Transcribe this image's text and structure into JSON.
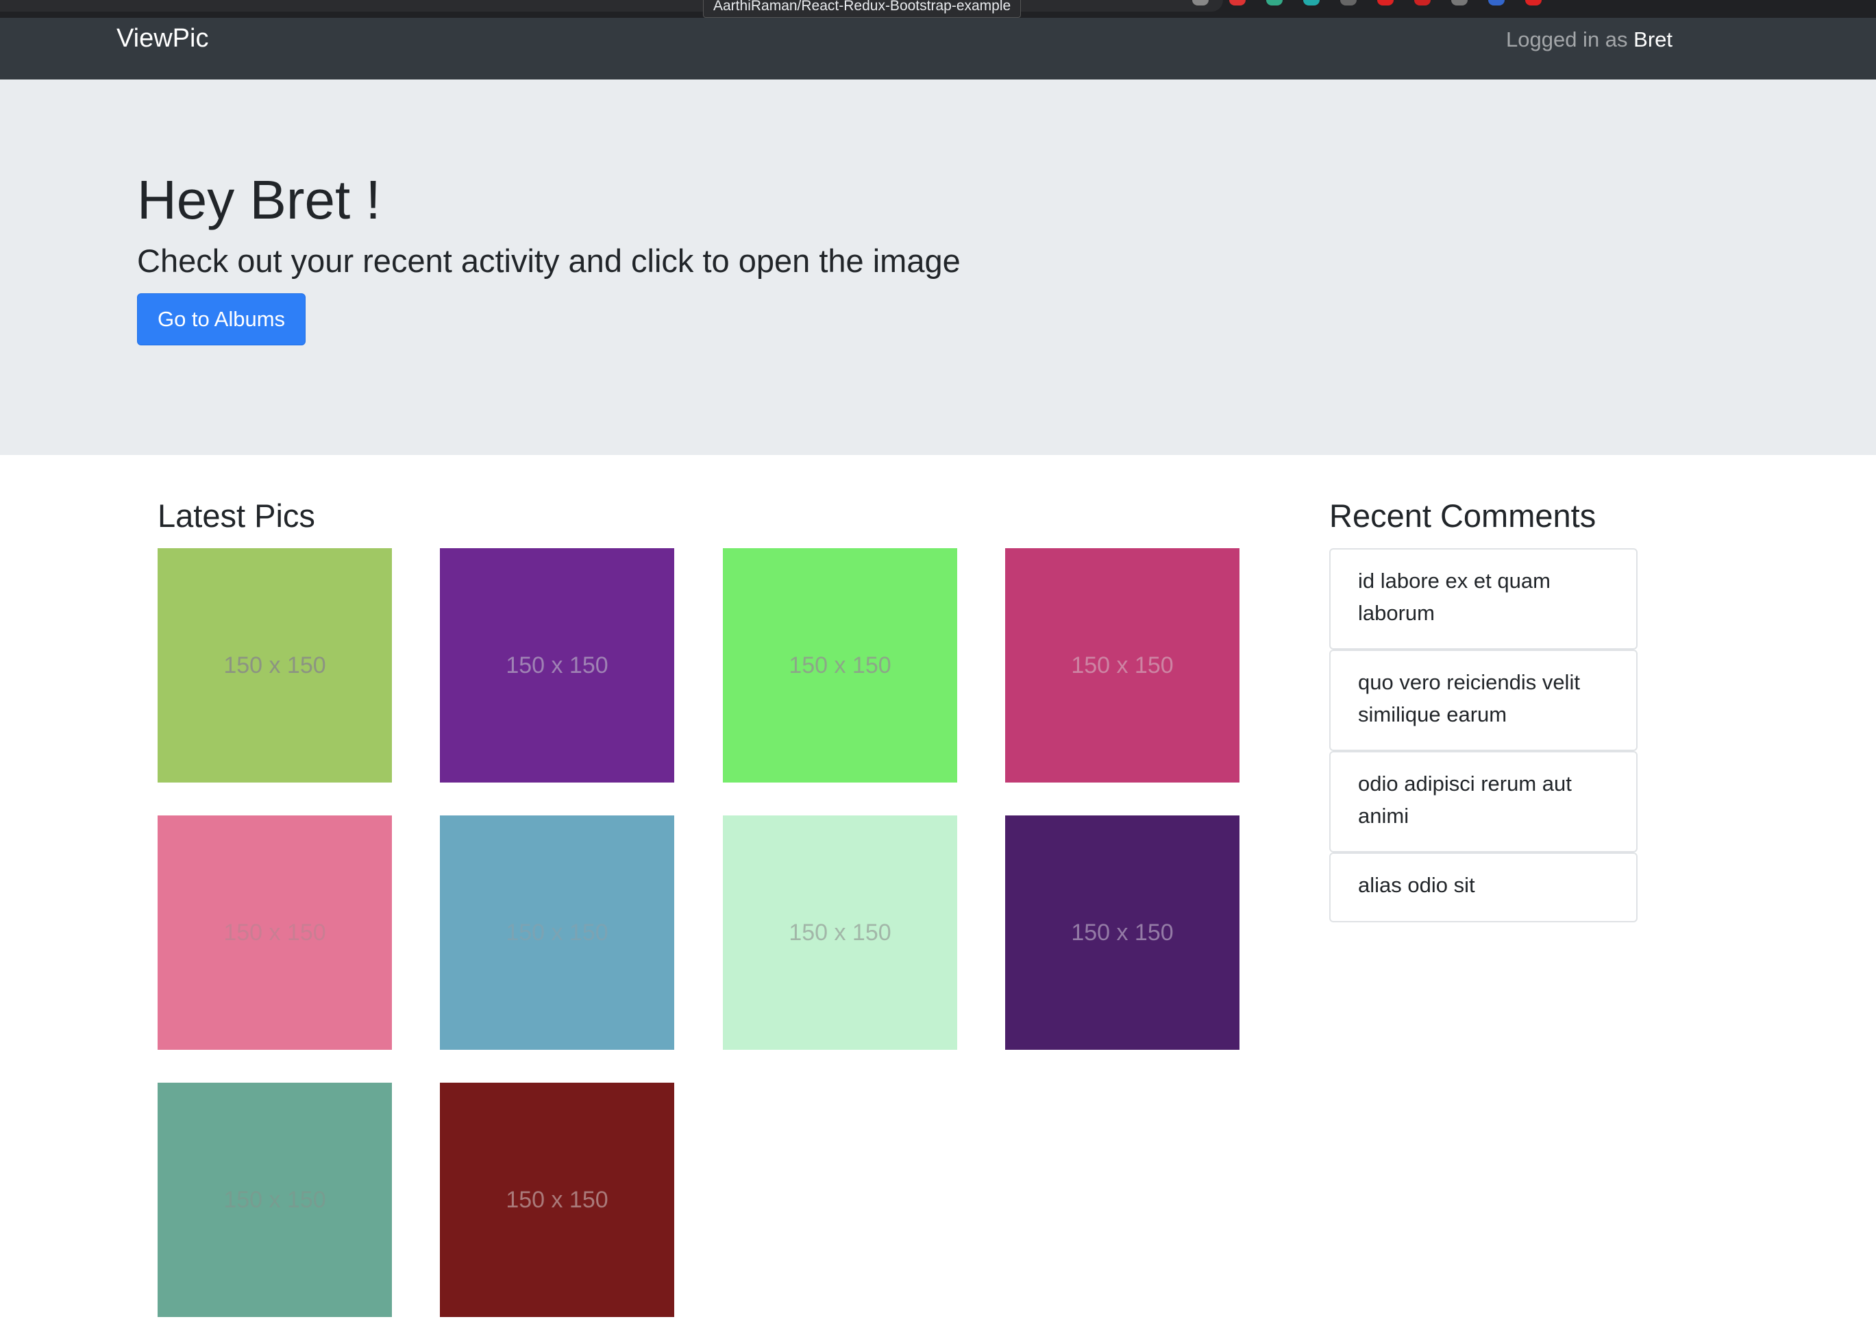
{
  "browser": {
    "tooltip": "AarthiRaman/React-Redux-Bootstrap-example"
  },
  "navbar": {
    "brand": "ViewPic",
    "logged_in_prefix": "Logged in as ",
    "user": "Bret"
  },
  "jumbotron": {
    "greeting": "Hey Bret !",
    "subtitle": "Check out your recent activity and click to open the image",
    "button_label": "Go to Albums"
  },
  "latest_pics": {
    "title": "Latest Pics",
    "items": [
      {
        "label": "150 x 150",
        "bg": "#a0c864",
        "fg": "#8a8f86"
      },
      {
        "label": "150 x 150",
        "bg": "#6d2891",
        "fg": "#a58cb8"
      },
      {
        "label": "150 x 150",
        "bg": "#76ec6c",
        "fg": "#8fa08c"
      },
      {
        "label": "150 x 150",
        "bg": "#c13b74",
        "fg": "#cf8ca9"
      },
      {
        "label": "150 x 150",
        "bg": "#e47696",
        "fg": "#c77f93"
      },
      {
        "label": "150 x 150",
        "bg": "#6aa8c0",
        "fg": "#7fa3b2"
      },
      {
        "label": "150 x 150",
        "bg": "#c2f2d0",
        "fg": "#9fb0a4"
      },
      {
        "label": "150 x 150",
        "bg": "#4b1f69",
        "fg": "#9d86ad"
      },
      {
        "label": "150 x 150",
        "bg": "#69a895",
        "fg": "#7a9b90"
      },
      {
        "label": "150 x 150",
        "bg": "#771a1a",
        "fg": "#b08585"
      }
    ]
  },
  "recent_comments": {
    "title": "Recent Comments",
    "items": [
      "id labore ex et quam laborum",
      "quo vero reiciendis velit similique earum",
      "odio adipisci rerum aut animi",
      "alias odio sit"
    ]
  }
}
